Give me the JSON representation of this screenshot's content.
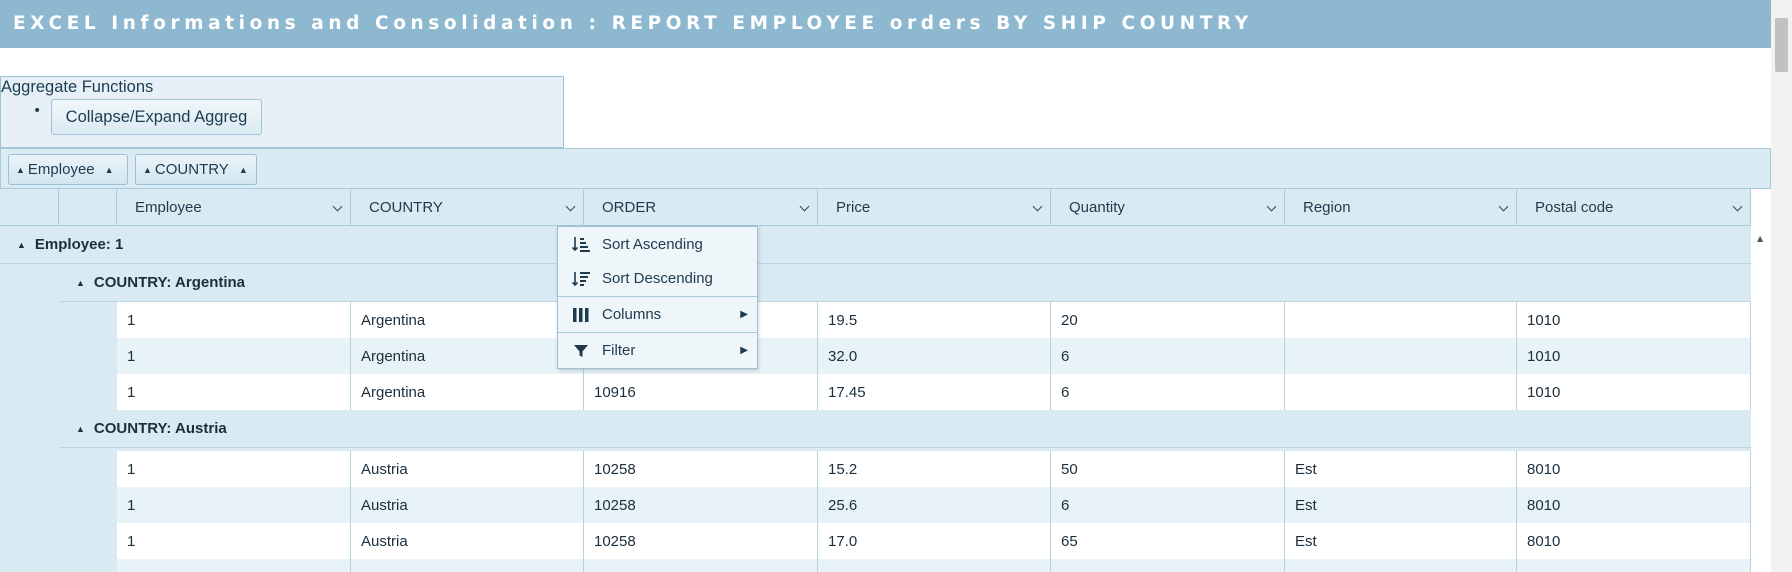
{
  "header": {
    "title": "EXCEL Informations and Consolidation : REPORT EMPLOYEE orders BY SHIP COUNTRY"
  },
  "aggregate": {
    "title": "Aggregate Functions",
    "bullet": "•",
    "button_label": "Collapse/Expand Aggreg"
  },
  "group_panel": {
    "chips": [
      {
        "label": "Employee",
        "arrow_left": "▲",
        "arrow_right": "▲"
      },
      {
        "label": "COUNTRY",
        "arrow_left": "▲",
        "arrow_right": "▲"
      }
    ]
  },
  "columns": [
    {
      "label": "Employee"
    },
    {
      "label": "COUNTRY"
    },
    {
      "label": "ORDER"
    },
    {
      "label": "Price"
    },
    {
      "label": "Quantity"
    },
    {
      "label": "Region"
    },
    {
      "label": "Postal code"
    }
  ],
  "groups": {
    "employee": {
      "label": "Employee: 1",
      "toggle": "▲"
    },
    "countries": [
      {
        "label": "COUNTRY: Argentina",
        "toggle": "▲",
        "rows": [
          [
            "1",
            "Argentina",
            "",
            "19.5",
            "20",
            "",
            "1010"
          ],
          [
            "1",
            "Argentina",
            "",
            "32.0",
            "6",
            "",
            "1010"
          ],
          [
            "1",
            "Argentina",
            "10916",
            "17.45",
            "6",
            "",
            "1010"
          ]
        ]
      },
      {
        "label": "COUNTRY: Austria",
        "toggle": "▲",
        "rows": [
          [
            "1",
            "Austria",
            "10258",
            "15.2",
            "50",
            "Est",
            "8010"
          ],
          [
            "1",
            "Austria",
            "10258",
            "25.6",
            "6",
            "Est",
            "8010"
          ],
          [
            "1",
            "Austria",
            "10258",
            "17.0",
            "65",
            "Est",
            "8010"
          ]
        ]
      }
    ]
  },
  "context_menu": {
    "items": [
      {
        "label": "Sort Ascending",
        "icon": "sort-ascending-icon"
      },
      {
        "label": "Sort Descending",
        "icon": "sort-descending-icon"
      },
      {
        "label": "Columns",
        "icon": "columns-icon",
        "submenu": "▶"
      },
      {
        "label": "Filter",
        "icon": "filter-icon",
        "submenu": "▶"
      }
    ]
  },
  "scroll": {
    "up_arrow": "▲"
  },
  "colors": {
    "banner": "#8db8cf",
    "header_bg": "#d9eaf3",
    "alt_row": "#e8f3f8",
    "border": "#a8cadb",
    "text": "#1b2f3c"
  }
}
